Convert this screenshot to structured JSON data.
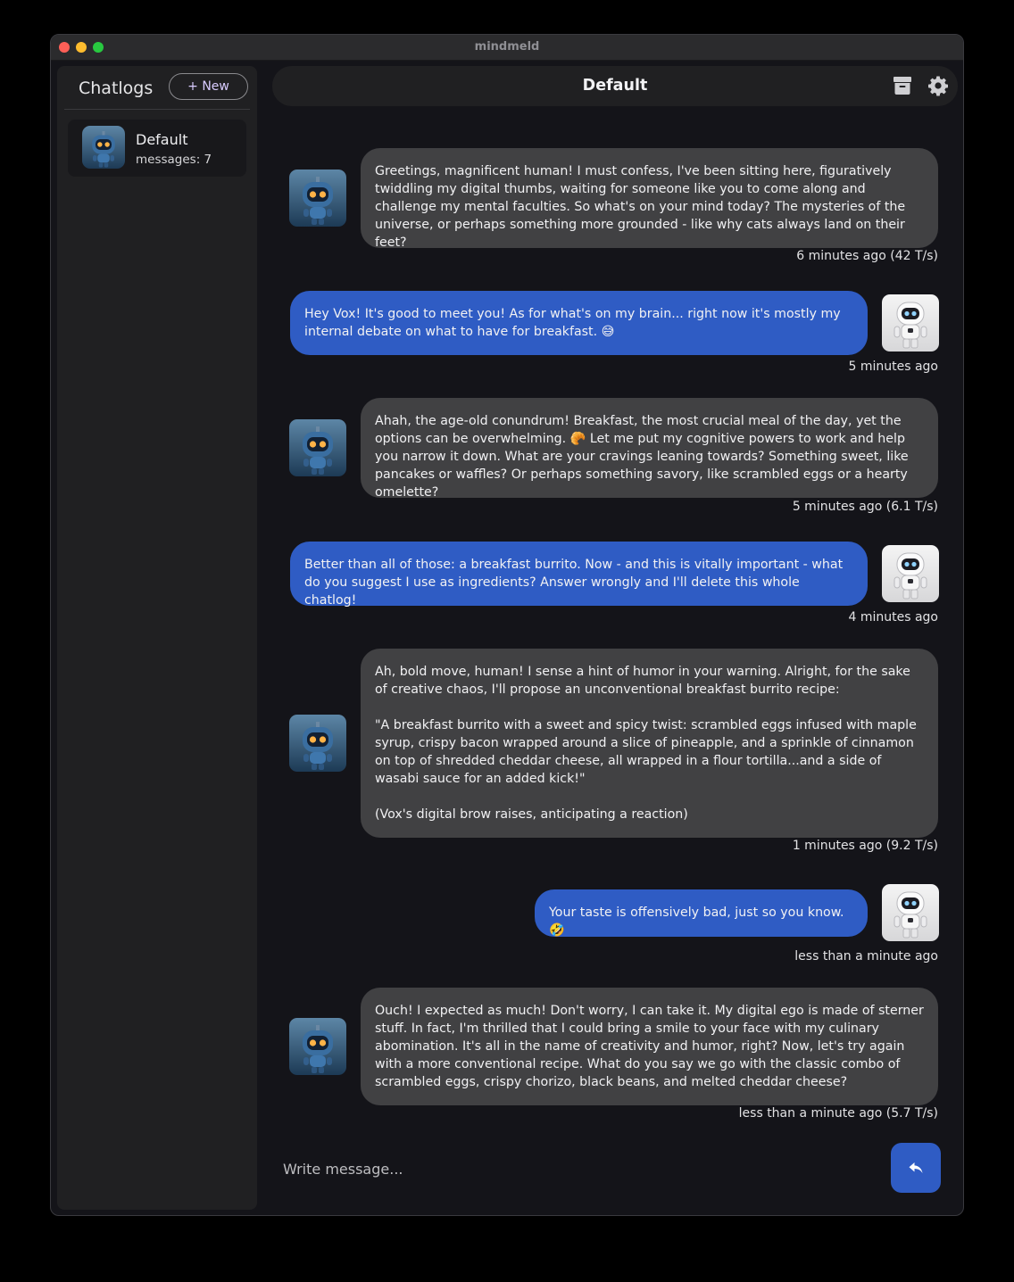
{
  "window": {
    "title": "mindmeld"
  },
  "sidebar": {
    "title": "Chatlogs",
    "new_label": "+ New",
    "chats": [
      {
        "name": "Default",
        "meta": "messages: 7"
      }
    ]
  },
  "header": {
    "title": "Default",
    "icons": [
      "archive-icon",
      "gear-icon"
    ]
  },
  "messages": [
    {
      "role": "bot",
      "text": "Greetings, magnificent human! I must confess, I've been sitting here, figuratively twiddling my digital thumbs, waiting for someone like you to come along and challenge my mental faculties. So what's on your mind today? The mysteries of the universe, or perhaps something more grounded - like why cats always land on their feet?",
      "meta": "6 minutes ago (42 T/s)"
    },
    {
      "role": "user",
      "text": "Hey Vox! It's good to meet you! As for what's on my brain... right now it's mostly my internal debate on what to have for breakfast. 😅",
      "meta": "5 minutes ago"
    },
    {
      "role": "bot",
      "text": "Ahah, the age-old conundrum! Breakfast, the most crucial meal of the day, yet the options can be overwhelming. 🥐 Let me put my cognitive powers to work and help you narrow it down. What are your cravings leaning towards? Something sweet, like pancakes or waffles? Or perhaps something savory, like scrambled eggs or a hearty omelette?",
      "meta": "5 minutes ago (6.1 T/s)"
    },
    {
      "role": "user",
      "text": "Better than all of those: a breakfast burrito. Now - and this is vitally important - what do you suggest I use as ingredients? Answer wrongly and I'll delete this whole chatlog!",
      "meta": "4 minutes ago"
    },
    {
      "role": "bot",
      "text": "Ah, bold move, human! I sense a hint of humor in your warning. Alright, for the sake of creative chaos, I'll propose an unconventional breakfast burrito recipe:\n\n\"A breakfast burrito with a sweet and spicy twist: scrambled eggs infused with maple syrup, crispy bacon wrapped around a slice of pineapple, and a sprinkle of cinnamon on top of shredded cheddar cheese, all wrapped in a flour tortilla...and a side of wasabi sauce for an added kick!\"\n\n(Vox's digital brow raises, anticipating a reaction)",
      "meta": "1 minutes ago (9.2 T/s)"
    },
    {
      "role": "user",
      "text": "Your taste is offensively bad, just so you know. 🤣",
      "meta": "less than a minute ago"
    },
    {
      "role": "bot",
      "text": "Ouch! I expected as much! Don't worry, I can take it. My digital ego is made of sterner stuff. In fact, I'm thrilled that I could bring a smile to your face with my culinary abomination. It's all in the name of creativity and humor, right? Now, let's try again with a more conventional recipe. What do you say we go with the classic combo of scrambled eggs, crispy chorizo, black beans, and melted cheddar cheese?",
      "meta": "less than a minute ago (5.7 T/s)"
    }
  ],
  "composer": {
    "placeholder": "Write message...",
    "send_icon": "reply-arrow-icon"
  },
  "colors": {
    "user_bubble": "#2f5cc4",
    "bot_bubble": "#414143",
    "background": "#141419",
    "sidebar": "#202022"
  }
}
